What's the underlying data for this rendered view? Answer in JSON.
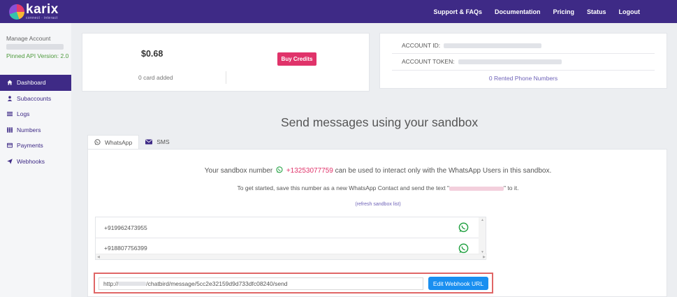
{
  "brand": {
    "name": "karix",
    "tagline": "connect · interact"
  },
  "nav": {
    "items": [
      "Support & FAQs",
      "Documentation",
      "Pricing",
      "Status",
      "Logout"
    ]
  },
  "sidebar": {
    "manage_account": "Manage Account",
    "pinned_api": "Pinned API Version: 2.0",
    "items": [
      {
        "label": "Dashboard",
        "icon": "home-icon"
      },
      {
        "label": "Subaccounts",
        "icon": "user-icon"
      },
      {
        "label": "Logs",
        "icon": "list-icon"
      },
      {
        "label": "Numbers",
        "icon": "grid-icon"
      },
      {
        "label": "Payments",
        "icon": "card-icon"
      },
      {
        "label": "Webhooks",
        "icon": "send-icon"
      }
    ]
  },
  "balance": {
    "amount": "$0.68",
    "cards_added": "0 card added",
    "buy_label": "Buy Credits"
  },
  "account": {
    "id_label": "ACCOUNT ID:",
    "token_label": "ACCOUNT TOKEN:",
    "rented": "0 Rented Phone Numbers"
  },
  "sandbox": {
    "title": "Send messages using your sandbox",
    "tabs": [
      {
        "label": "WhatsApp",
        "icon": "whatsapp-icon"
      },
      {
        "label": "SMS",
        "icon": "envelope-icon"
      }
    ],
    "line1_prefix": "Your sandbox number",
    "number": "+13253077759",
    "line1_suffix": "can be used to interact only with the WhatsApp Users in this sandbox.",
    "line2_prefix": "To get started, save this number as a new WhatsApp Contact and send the text \"",
    "line2_suffix": "\" to it.",
    "refresh": "(refresh sandbox list)",
    "numbers": [
      "+919962473955",
      "+918807756399"
    ],
    "webhook_prefix": "http://",
    "webhook_suffix": "/chatbird/message/5cc2e32159d9d733dfc08240/send",
    "edit_label": "Edit Webhook URL"
  },
  "colors": {
    "brand_purple": "#3e2a86",
    "accent_pink": "#e0336a",
    "button_blue": "#1a8ff0",
    "whatsapp_green": "#25a244"
  }
}
